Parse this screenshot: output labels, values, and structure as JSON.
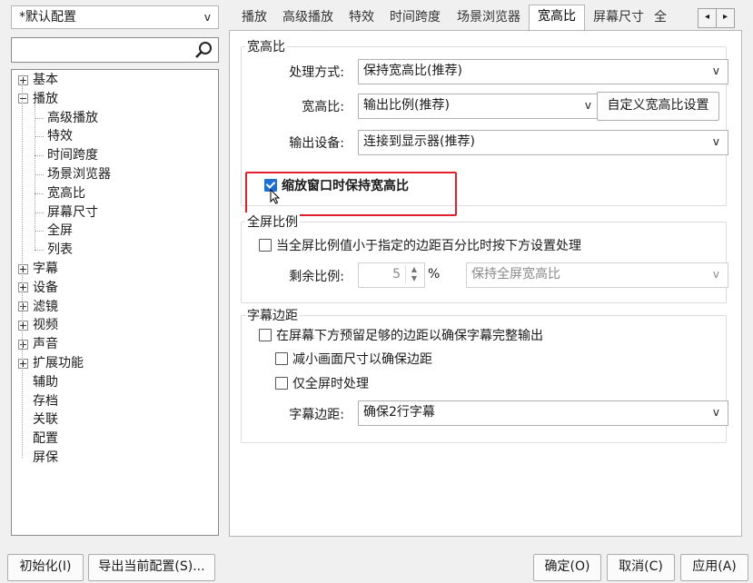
{
  "profile": {
    "selected": "*默认配置"
  },
  "tree": {
    "items": [
      {
        "label": "基本",
        "expander": "plus"
      },
      {
        "label": "播放",
        "expander": "minus"
      },
      {
        "label": "高级播放"
      },
      {
        "label": "特效"
      },
      {
        "label": "时间跨度"
      },
      {
        "label": "场景浏览器"
      },
      {
        "label": "宽高比"
      },
      {
        "label": "屏幕尺寸"
      },
      {
        "label": "全屏"
      },
      {
        "label": "列表"
      },
      {
        "label": "字幕",
        "expander": "plus"
      },
      {
        "label": "设备",
        "expander": "plus"
      },
      {
        "label": "滤镜",
        "expander": "plus"
      },
      {
        "label": "视频",
        "expander": "plus"
      },
      {
        "label": "声音",
        "expander": "plus"
      },
      {
        "label": "扩展功能",
        "expander": "plus"
      },
      {
        "label": "辅助"
      },
      {
        "label": "存档"
      },
      {
        "label": "关联"
      },
      {
        "label": "配置"
      },
      {
        "label": "屏保"
      }
    ]
  },
  "tabs": [
    {
      "label": "播放"
    },
    {
      "label": "高级播放"
    },
    {
      "label": "特效"
    },
    {
      "label": "时间跨度"
    },
    {
      "label": "场景浏览器"
    },
    {
      "label": "宽高比",
      "active": true
    },
    {
      "label": "屏幕尺寸"
    },
    {
      "label": "全"
    }
  ],
  "aspect_group": {
    "title": "宽高比",
    "method_label": "处理方式:",
    "method_value": "保持宽高比(推荐)",
    "ratio_label": "宽高比:",
    "ratio_value": "输出比例(推荐)",
    "custom_button": "自定义宽高比设置",
    "device_label": "输出设备:",
    "device_value": "连接到显示器(推荐)",
    "keep_on_resize": {
      "label": "缩放窗口时保持宽高比",
      "checked": true
    }
  },
  "fullscreen_group": {
    "title": "全屏比例",
    "process_check": {
      "label": "当全屏比例值小于指定的边距百分比时按下方设置处理",
      "checked": false
    },
    "remaining_label": "剩余比例:",
    "remaining_value": "5",
    "remaining_unit": "%",
    "mode_value": "保持全屏宽高比"
  },
  "subtitle_group": {
    "title": "字幕边距",
    "reserve_check": {
      "label": "在屏幕下方预留足够的边距以确保字幕完整输出",
      "checked": false
    },
    "shrink_check": {
      "label": "减小画面尺寸以确保边距",
      "checked": false
    },
    "fullscreen_only_check": {
      "label": "仅全屏时处理",
      "checked": false
    },
    "margin_label": "字幕边距:",
    "margin_value": "确保2行字幕"
  },
  "footer": {
    "init_button": "初始化(I)",
    "export_button": "导出当前配置(S)...",
    "ok_button": "确定(O)",
    "cancel_button": "取消(C)",
    "apply_button": "应用(A)"
  },
  "colors": {
    "highlight": "#e0202a",
    "checkbox_accent": "#1e6fd2"
  }
}
